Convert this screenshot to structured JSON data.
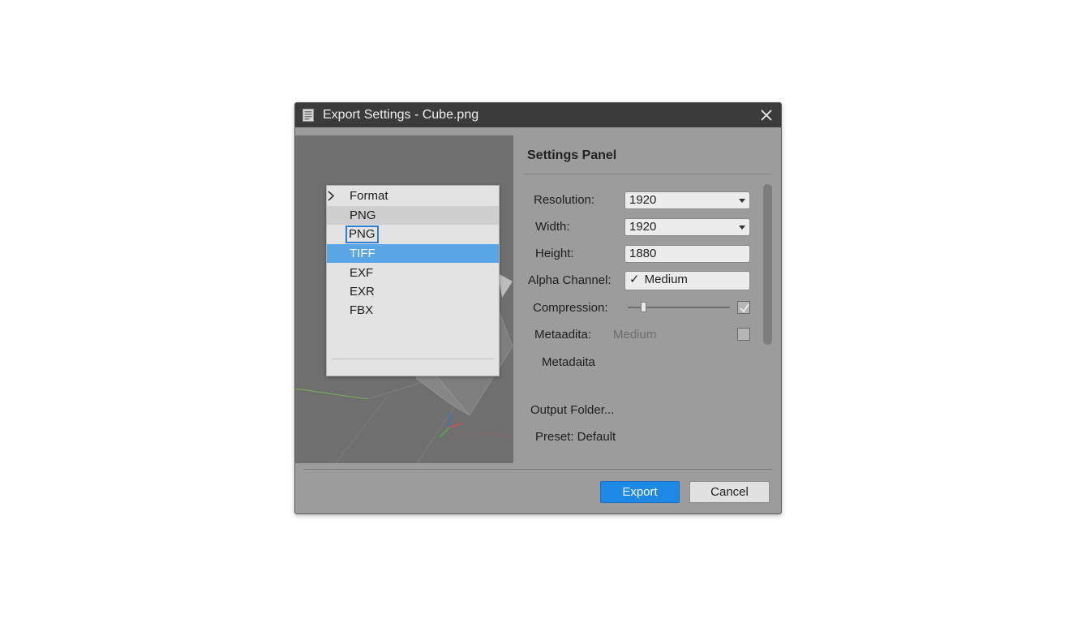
{
  "window": {
    "title": "Export Settings - Cube.png",
    "icon": "document-icon",
    "close_icon": "close-icon"
  },
  "format_menu": {
    "header": "Format",
    "items": [
      "PNG",
      "PNG",
      "TIFF",
      "EXF",
      "EXR",
      "FBX"
    ],
    "hovered": "PNG",
    "focused": "PNG",
    "selected": "TIFF"
  },
  "settings": {
    "panel_title": "Settings Panel",
    "resolution": {
      "label": "Resolution:",
      "value": "1920"
    },
    "width": {
      "label": "Width:",
      "value": "1920"
    },
    "height": {
      "label": "Height:",
      "value": "1880"
    },
    "alpha_channel": {
      "label": "Alpha Channel:",
      "value": "Medium",
      "check": "✓"
    },
    "compression": {
      "label": "Compression:",
      "level": 0.15,
      "checked": true
    },
    "metadata_row": {
      "label": "Metaadita:",
      "value": "Medium",
      "checked": false
    },
    "metadata_text": "Metadaita",
    "output_folder": "Output Folder...",
    "preset": "Preset: Default"
  },
  "buttons": {
    "export": "Export",
    "cancel": "Cancel"
  },
  "colors": {
    "accent": "#1e88e5",
    "selection": "#5aa5e6",
    "titlebar": "#3b3b3b",
    "dialog": "#9c9c9c"
  }
}
